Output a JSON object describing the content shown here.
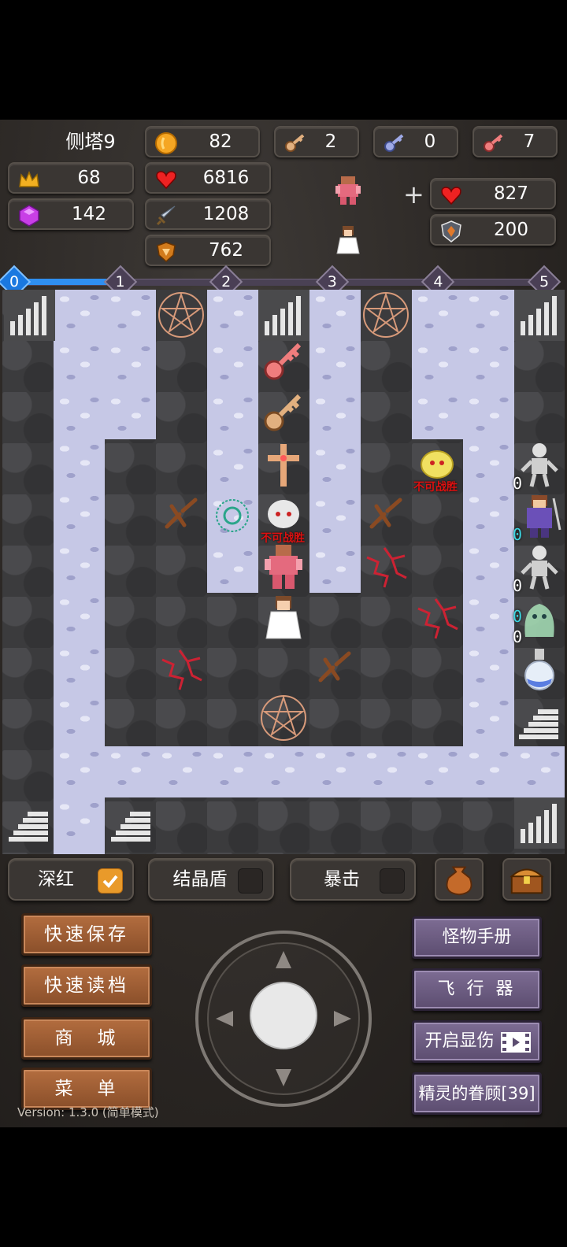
{
  "floor": "侧塔9",
  "stats": {
    "gold": "82",
    "level": "68",
    "gems": "142",
    "hp": "6816",
    "attack": "1208",
    "defense": "762",
    "yellow_keys": "2",
    "blue_keys": "0",
    "red_keys": "7",
    "plus_sign": "+",
    "bonus_hp": "827",
    "bonus_def": "200"
  },
  "progress": {
    "nodes": [
      "0",
      "1",
      "2",
      "3",
      "4",
      "5"
    ],
    "current": 0,
    "fill_fraction": 0.18
  },
  "map": {
    "enemy_tags": [
      "不可战胜",
      "不可战胜"
    ],
    "damage_labels": [
      "0",
      "0",
      "0",
      "0",
      "0"
    ]
  },
  "toggles": [
    {
      "label": "深红",
      "checked": true
    },
    {
      "label": "结晶盾",
      "checked": false
    },
    {
      "label": "暴击",
      "checked": false
    }
  ],
  "left_buttons": [
    "快速保存",
    "快速读档",
    "商　城",
    "菜　单"
  ],
  "right_buttons": {
    "monster_book": "怪物手册",
    "flyer": "飞 行 器",
    "show_damage": "开启显伤",
    "fairy_blessing": "精灵的眷顾[39]"
  },
  "version": "Version: 1.3.0 (简单模式)",
  "colors": {
    "progress_active": "#2f8ff0",
    "wood_button": "#a5603a",
    "purple_button": "#6f5f86",
    "checkbox_on": "#e99a2a"
  }
}
